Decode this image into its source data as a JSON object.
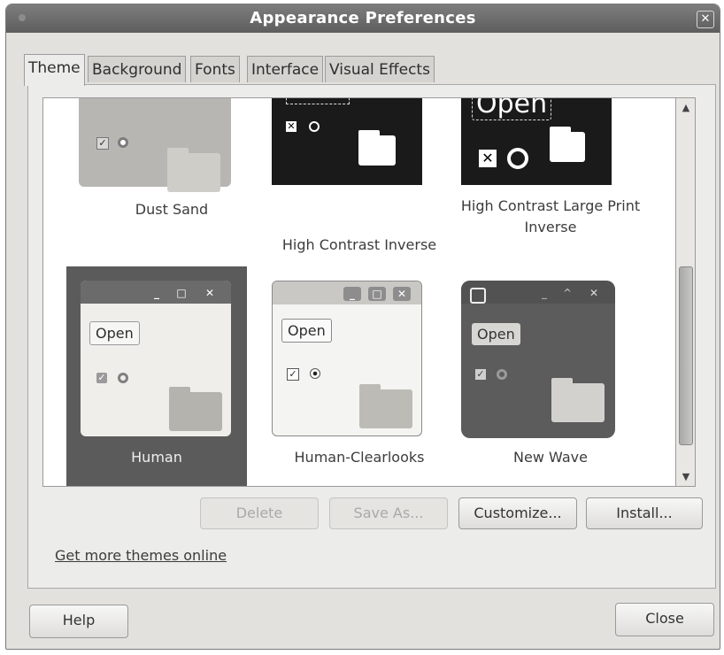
{
  "window": {
    "title": "Appearance Preferences",
    "close_glyph": "✕"
  },
  "tabs": [
    {
      "label": "Theme",
      "active": true
    },
    {
      "label": "Background",
      "active": false
    },
    {
      "label": "Fonts",
      "active": false
    },
    {
      "label": "Interface",
      "active": false
    },
    {
      "label": "Visual Effects",
      "active": false
    }
  ],
  "themes": [
    {
      "name": "Dust Sand",
      "selected": false
    },
    {
      "name": "High Contrast Inverse",
      "selected": false
    },
    {
      "name": "High Contrast Large Print Inverse",
      "selected": false
    },
    {
      "name": "Human",
      "selected": true
    },
    {
      "name": "Human-Clearlooks",
      "selected": false
    },
    {
      "name": "New Wave",
      "selected": false
    }
  ],
  "thumb_labels": {
    "open": "Open",
    "check_glyph": "✓",
    "x_glyph": "✕",
    "min_glyph": "_",
    "max_glyph": "□",
    "up_glyph": "^",
    "close_glyph": "✕"
  },
  "scrollbar": {
    "up_arrow": "▲",
    "down_arrow": "▼"
  },
  "actions": {
    "delete": "Delete",
    "save_as": "Save As...",
    "customize": "Customize...",
    "install": "Install..."
  },
  "link": {
    "get_more_themes": "Get more themes online"
  },
  "footer": {
    "help": "Help",
    "close": "Close"
  },
  "colors": {
    "titlebar": "#6a6a6a",
    "selection": "#5b5b5b",
    "dust_sand": "#b8b6b2",
    "high_contrast": "#1a1a1a",
    "new_wave": "#5c5c5c"
  }
}
